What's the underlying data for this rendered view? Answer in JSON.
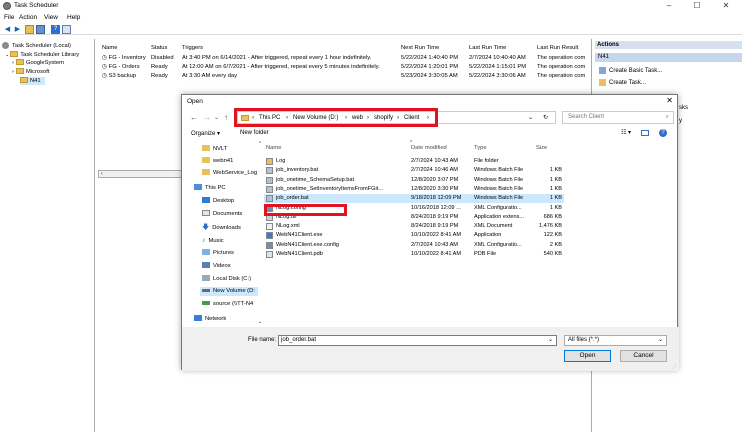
{
  "window": {
    "title": "Task Scheduler",
    "minimize": "–",
    "maximize": "☐",
    "close": "✕"
  },
  "menu": [
    "File",
    "Action",
    "View",
    "Help"
  ],
  "tree": [
    {
      "label": "Task Scheduler (Local)"
    },
    {
      "label": "Task Scheduler Library"
    },
    {
      "label": "GoogleSystem"
    },
    {
      "label": "Microsoft"
    },
    {
      "label": "N41"
    }
  ],
  "tasks": {
    "headers": [
      "Name",
      "Status",
      "Triggers",
      "Next Run Time",
      "Last Run Time",
      "Last Run Result"
    ],
    "rows": [
      [
        "FG - Inventory",
        "Disabled",
        "At 3:40 PM on 6/14/2021 - After triggered, repeat every 1 hour indefinitely.",
        "5/22/2024 1:40:40 PM",
        "2/7/2024 10:40:40 AM",
        "The operation com"
      ],
      [
        "FG - Orders",
        "Ready",
        "At 12:00 AM on 6/7/2021 - After triggered, repeat every 5 minutes indefinitely.",
        "5/22/2024 1:20:01 PM",
        "5/22/2024 1:15:01 PM",
        "The operation com"
      ],
      [
        "S3 backup",
        "Ready",
        "At 3:30 AM every day",
        "5/23/2024 3:30:05 AM",
        "5/22/2024 3:30:06 AM",
        "The operation com"
      ]
    ]
  },
  "actions": {
    "header": "Actions",
    "selected": "N41",
    "items": [
      "Create Basic Task...",
      "Create Task..."
    ],
    "partial": [
      "sks",
      "y"
    ]
  },
  "dialog": {
    "title": "Open",
    "close": "✕",
    "breadcrumb": [
      "This PC",
      "New Volume (D:)",
      "web",
      "shopify",
      "Client"
    ],
    "search_placeholder": "Search Client",
    "organize": "Organize ▾",
    "new_folder": "New folder",
    "nav": [
      {
        "label": "NVLT",
        "icon": "folder"
      },
      {
        "label": "webn41",
        "icon": "folder"
      },
      {
        "label": "WebService_Log",
        "icon": "folder"
      },
      {
        "label": "This PC",
        "icon": "pc"
      },
      {
        "label": "Desktop",
        "icon": "desktop"
      },
      {
        "label": "Documents",
        "icon": "documents"
      },
      {
        "label": "Downloads",
        "icon": "downloads"
      },
      {
        "label": "Music",
        "icon": "music"
      },
      {
        "label": "Pictures",
        "icon": "pictures"
      },
      {
        "label": "Videos",
        "icon": "videos"
      },
      {
        "label": "Local Disk (C:)",
        "icon": "disk"
      },
      {
        "label": "New Volume (D:",
        "icon": "disk"
      },
      {
        "label": "source (\\\\TT-N4",
        "icon": "network-drive"
      },
      {
        "label": "Network",
        "icon": "network"
      }
    ],
    "columns": [
      "Name",
      "Date modified",
      "Type",
      "Size"
    ],
    "files": [
      {
        "name": "Log",
        "date": "2/7/2024 10:43 AM",
        "type": "File folder",
        "size": "",
        "icon": "folder"
      },
      {
        "name": "job_inventory.bat",
        "date": "2/7/2024 10:46 AM",
        "type": "Windows Batch File",
        "size": "1 KB",
        "icon": "bat"
      },
      {
        "name": "job_onetime_SchemaSetup.bat",
        "date": "12/8/2020 3:07 PM",
        "type": "Windows Batch File",
        "size": "1 KB",
        "icon": "bat"
      },
      {
        "name": "job_onetime_SetInventoryItemsFromFGit...",
        "date": "12/8/2020 3:30 PM",
        "type": "Windows Batch File",
        "size": "1 KB",
        "icon": "bat"
      },
      {
        "name": "job_order.bat",
        "date": "9/18/2018 12:09 PM",
        "type": "Windows Batch File",
        "size": "1 KB",
        "icon": "bat"
      },
      {
        "name": "NLog.config",
        "date": "10/16/2018 12:09 ...",
        "type": "XML Configuratio...",
        "size": "1 KB",
        "icon": "config"
      },
      {
        "name": "NLog.dll",
        "date": "8/24/2018 9:19 PM",
        "type": "Application extens...",
        "size": "686 KB",
        "icon": "dll"
      },
      {
        "name": "NLog.xml",
        "date": "8/24/2018 9:19 PM",
        "type": "XML Document",
        "size": "1,476 KB",
        "icon": "xml"
      },
      {
        "name": "WebN41Client.exe",
        "date": "10/10/2022 8:41 AM",
        "type": "Application",
        "size": "122 KB",
        "icon": "exe"
      },
      {
        "name": "WebN41Client.exe.config",
        "date": "2/7/2024 10:43 AM",
        "type": "XML Configuratio...",
        "size": "2 KB",
        "icon": "config"
      },
      {
        "name": "WebN41Client.pdb",
        "date": "10/10/2022 8:41 AM",
        "type": "PDB File",
        "size": "540 KB",
        "icon": "pdb"
      }
    ],
    "selected_index": 4,
    "filename_label": "File name:",
    "filename_value": "job_order.bat",
    "filetype": "All files (*.*)",
    "open_label": "Open",
    "cancel_label": "Cancel"
  },
  "colors": {
    "selection": "#cce8ff",
    "highlight_box": "#e0141e",
    "folder": "#e8c15a",
    "accent": "#0078d7"
  }
}
